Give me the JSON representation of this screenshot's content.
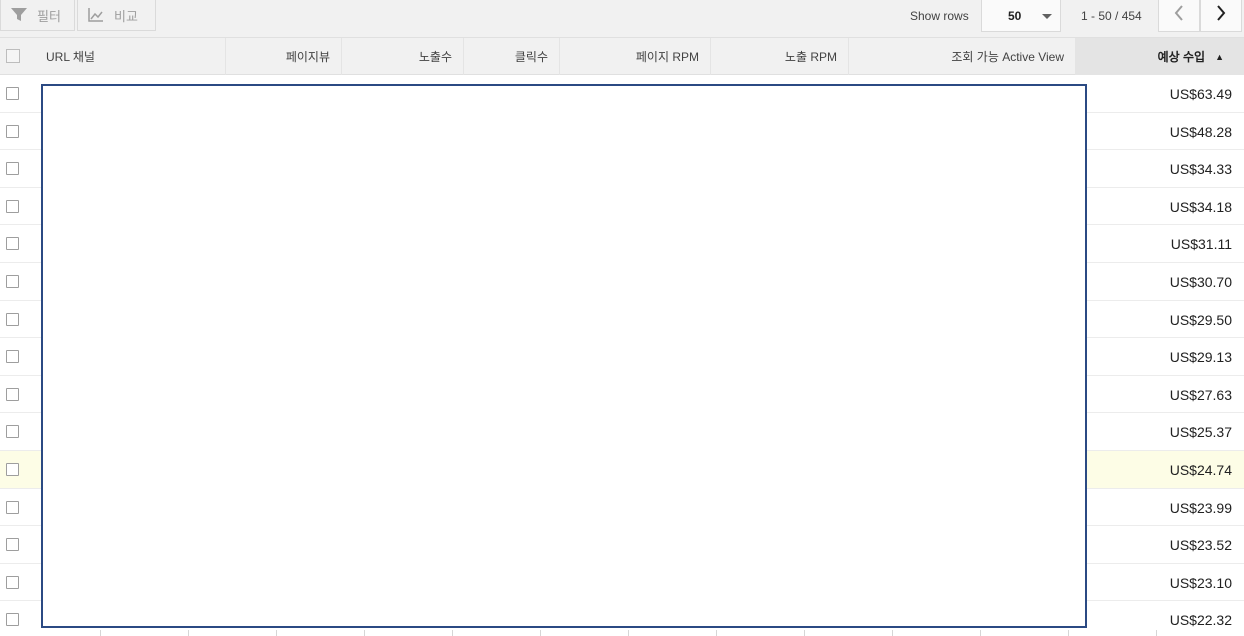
{
  "toolbar": {
    "filter_label": "필터",
    "filter_icon": "filter-icon",
    "compare_label": "비교",
    "compare_icon": "chart-line-icon",
    "show_rows_label": "Show rows",
    "rows_value": "50",
    "pager_text": "1 - 50 / 454"
  },
  "columns": [
    {
      "label": "URL 채널"
    },
    {
      "label": "페이지뷰"
    },
    {
      "label": "노출수"
    },
    {
      "label": "클릭수"
    },
    {
      "label": "페이지 RPM"
    },
    {
      "label": "노출 RPM"
    },
    {
      "label": "조회 가능 Active View"
    },
    {
      "label": "예상 수입",
      "sort": "▲"
    }
  ],
  "rows": [
    {
      "earnings": "US$63.49"
    },
    {
      "earnings": "US$48.28"
    },
    {
      "earnings": "US$34.33"
    },
    {
      "earnings": "US$34.18"
    },
    {
      "earnings": "US$31.11"
    },
    {
      "earnings": "US$30.70"
    },
    {
      "earnings": "US$29.50"
    },
    {
      "earnings": "US$29.13"
    },
    {
      "earnings": "US$27.63"
    },
    {
      "earnings": "US$25.37"
    },
    {
      "earnings": "US$24.74"
    },
    {
      "earnings": "US$23.99"
    },
    {
      "earnings": "US$23.52"
    },
    {
      "earnings": "US$23.10"
    },
    {
      "earnings": "US$22.32"
    }
  ],
  "colors": {
    "highlight_row": "#fdfde6",
    "redaction_border": "#2b4a83"
  }
}
